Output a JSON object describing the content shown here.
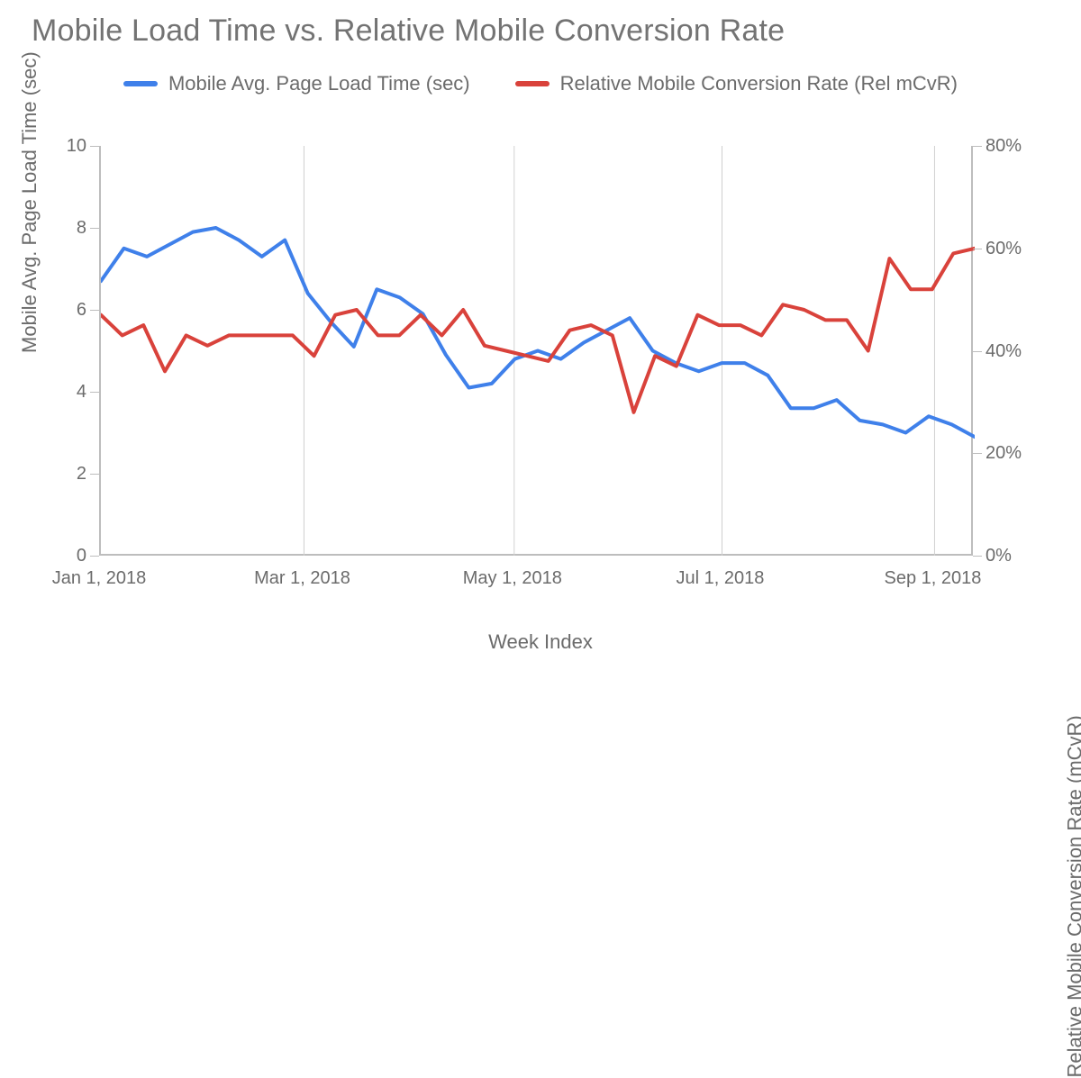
{
  "title": "Mobile Load Time vs. Relative Mobile Conversion Rate",
  "legend": {
    "series1": "Mobile Avg. Page Load Time (sec)",
    "series2": "Relative Mobile Conversion Rate (Rel mCvR)"
  },
  "axes": {
    "x_title": "Week Index",
    "y_left_title": "Mobile Avg. Page Load Time (sec)",
    "y_right_title": "Relative Mobile Conversion Rate (mCvR)",
    "y_left_ticks": [
      "0",
      "2",
      "4",
      "6",
      "8",
      "10"
    ],
    "y_right_ticks": [
      "0%",
      "20%",
      "40%",
      "60%",
      "80%"
    ],
    "x_ticks": [
      "Jan 1, 2018",
      "Mar 1, 2018",
      "May 1, 2018",
      "Jul 1, 2018",
      "Sep 1, 2018"
    ]
  },
  "colors": {
    "series1": "#3f80ea",
    "series2": "#d9423b",
    "grid": "#d0d0d0",
    "axis": "#bdbdbd"
  },
  "chart_data": {
    "type": "line",
    "x_label": "Week Index",
    "x": [
      0,
      1,
      2,
      3,
      4,
      5,
      6,
      7,
      8,
      9,
      10,
      11,
      12,
      13,
      14,
      15,
      16,
      17,
      18,
      19,
      20,
      21,
      22,
      23,
      24,
      25,
      26,
      27,
      28,
      29,
      30,
      31,
      32,
      33,
      34,
      35,
      36,
      37
    ],
    "x_tick_positions": [
      0,
      8.6,
      17.5,
      26.3,
      35.3
    ],
    "x_tick_labels": [
      "Jan 1, 2018",
      "Mar 1, 2018",
      "May 1, 2018",
      "Jul 1, 2018",
      "Sep 1, 2018"
    ],
    "series": [
      {
        "name": "Mobile Avg. Page Load Time (sec)",
        "axis": "left",
        "y": [
          6.7,
          7.5,
          7.3,
          7.6,
          7.9,
          8.0,
          7.7,
          7.3,
          7.7,
          6.4,
          5.7,
          5.1,
          6.5,
          6.3,
          5.9,
          4.9,
          4.1,
          4.2,
          4.8,
          5.0,
          4.8,
          5.2,
          5.5,
          5.8,
          5.0,
          4.7,
          4.5,
          4.7,
          4.7,
          4.4,
          3.6,
          3.6,
          3.8,
          3.3,
          3.2,
          3.0,
          3.4,
          3.2,
          2.9
        ]
      },
      {
        "name": "Relative Mobile Conversion Rate (Rel mCvR)",
        "axis": "right",
        "y": [
          47,
          43,
          45,
          36,
          43,
          41,
          43,
          43,
          43,
          43,
          39,
          47,
          48,
          43,
          43,
          47,
          43,
          48,
          41,
          40,
          39,
          38,
          44,
          45,
          43,
          28,
          39,
          37,
          47,
          45,
          45,
          43,
          49,
          48,
          46,
          46,
          40,
          58,
          52,
          52,
          59,
          60
        ]
      }
    ],
    "y_left": {
      "label": "Mobile Avg. Page Load Time (sec)",
      "range": [
        0,
        10
      ],
      "ticks": [
        0,
        2,
        4,
        6,
        8,
        10
      ]
    },
    "y_right": {
      "label": "Relative Mobile Conversion Rate (mCvR)",
      "range": [
        0,
        80
      ],
      "ticks": [
        0,
        20,
        40,
        60,
        80
      ],
      "unit": "%"
    }
  }
}
